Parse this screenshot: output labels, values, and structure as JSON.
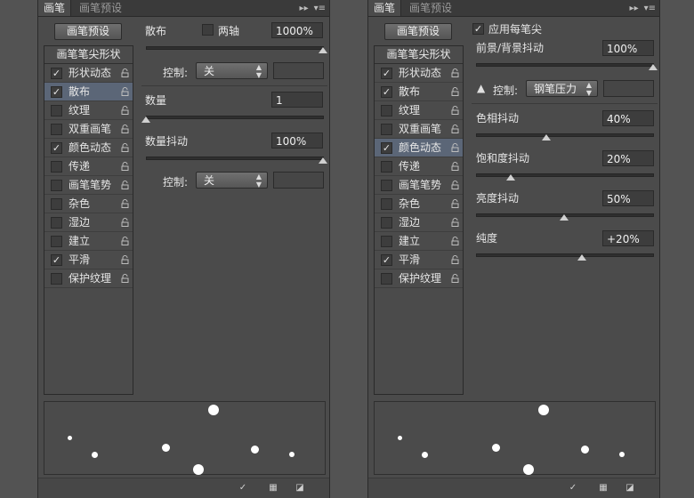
{
  "left": {
    "tabs": [
      "画笔",
      "画笔预设"
    ],
    "preset_button": "画笔预设",
    "list_header": "画笔笔尖形状",
    "items": [
      {
        "label": "形状动态",
        "checked": true
      },
      {
        "label": "散布",
        "checked": true
      },
      {
        "label": "纹理",
        "checked": false
      },
      {
        "label": "双重画笔",
        "checked": false
      },
      {
        "label": "颜色动态",
        "checked": true
      },
      {
        "label": "传递",
        "checked": false
      },
      {
        "label": "画笔笔势",
        "checked": false
      },
      {
        "label": "杂色",
        "checked": false
      },
      {
        "label": "湿边",
        "checked": false
      },
      {
        "label": "建立",
        "checked": false
      },
      {
        "label": "平滑",
        "checked": true
      },
      {
        "label": "保护纹理",
        "checked": false
      }
    ],
    "scatter": {
      "label": "散布",
      "both_axes": "两轴",
      "value": "1000%",
      "slider": 1.0
    },
    "control1": {
      "label": "控制:",
      "value": "关"
    },
    "count": {
      "label": "数量",
      "value": "1",
      "slider": 0.0
    },
    "count_jitter": {
      "label": "数量抖动",
      "value": "100%",
      "slider": 1.0
    },
    "control2": {
      "label": "控制:",
      "value": "关"
    }
  },
  "right": {
    "tabs": [
      "画笔",
      "画笔预设"
    ],
    "preset_button": "画笔预设",
    "list_header": "画笔笔尖形状",
    "items": [
      {
        "label": "形状动态",
        "checked": true
      },
      {
        "label": "散布",
        "checked": true
      },
      {
        "label": "纹理",
        "checked": false
      },
      {
        "label": "双重画笔",
        "checked": false
      },
      {
        "label": "颜色动态",
        "checked": true
      },
      {
        "label": "传递",
        "checked": false
      },
      {
        "label": "画笔笔势",
        "checked": false
      },
      {
        "label": "杂色",
        "checked": false
      },
      {
        "label": "湿边",
        "checked": false
      },
      {
        "label": "建立",
        "checked": false
      },
      {
        "label": "平滑",
        "checked": true
      },
      {
        "label": "保护纹理",
        "checked": false
      }
    ],
    "apply_per_tip": "应用每笔尖",
    "fgbg": {
      "label": "前景/背景抖动",
      "value": "100%",
      "slider": 1.0
    },
    "control": {
      "label": "控制:",
      "value": "钢笔压力"
    },
    "hue": {
      "label": "色相抖动",
      "value": "40%",
      "slider": 0.4
    },
    "saturation": {
      "label": "饱和度抖动",
      "value": "20%",
      "slider": 0.2
    },
    "brightness": {
      "label": "亮度抖动",
      "value": "50%",
      "slider": 0.5
    },
    "purity": {
      "label": "纯度",
      "value": "+20%",
      "slider": 0.6
    }
  },
  "colors": {
    "panel": "#4b4b4b",
    "selected_row": "#5b6677",
    "field": "#3d3d3d"
  }
}
